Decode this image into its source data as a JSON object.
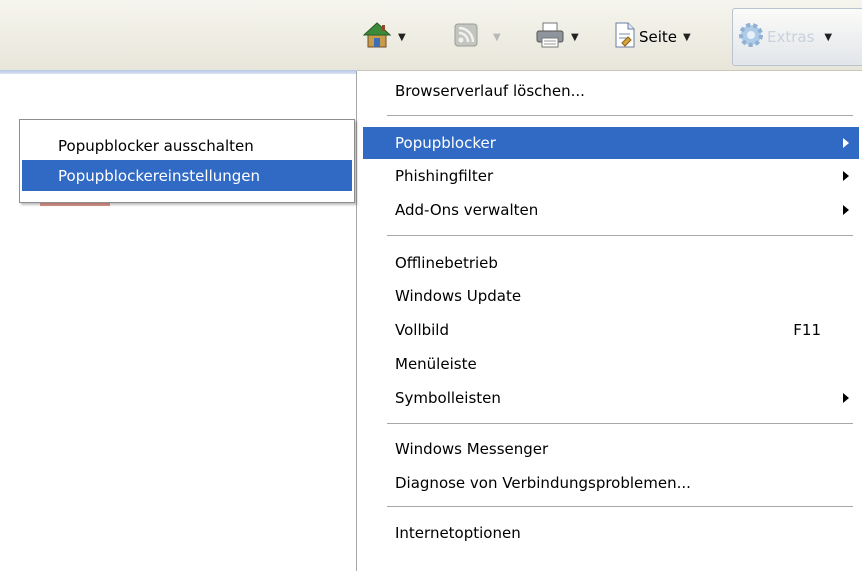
{
  "toolbar": {
    "home_icon": "home-icon",
    "feeds_icon": "rss-feed-icon",
    "print_icon": "printer-icon",
    "page_icon": "page-icon",
    "page_label": "Seite",
    "tools_icon": "gear-icon",
    "tools_label": "Extras"
  },
  "extras_menu": {
    "items": [
      {
        "label": "Browserverlauf löschen..."
      },
      {
        "label": "Popupblocker",
        "submenu": true,
        "highlighted": true
      },
      {
        "label": "Phishingfilter",
        "submenu": true
      },
      {
        "label": "Add-Ons verwalten",
        "submenu": true
      },
      {
        "label": "Offlinebetrieb"
      },
      {
        "label": "Windows Update"
      },
      {
        "label": "Vollbild",
        "shortcut": "F11"
      },
      {
        "label": "Menüleiste"
      },
      {
        "label": "Symbolleisten",
        "submenu": true
      },
      {
        "label": "Windows Messenger"
      },
      {
        "label": "Diagnose von Verbindungsproblemen..."
      },
      {
        "label": "Internetoptionen"
      }
    ]
  },
  "popup_submenu": {
    "items": [
      {
        "label": "Popupblocker ausschalten"
      },
      {
        "label": "Popupblockereinstellungen",
        "highlighted": true
      }
    ]
  },
  "colors": {
    "highlight": "#316ac5",
    "toolbar_bg": "#ecebe2",
    "separator": "#a8a8a8"
  }
}
